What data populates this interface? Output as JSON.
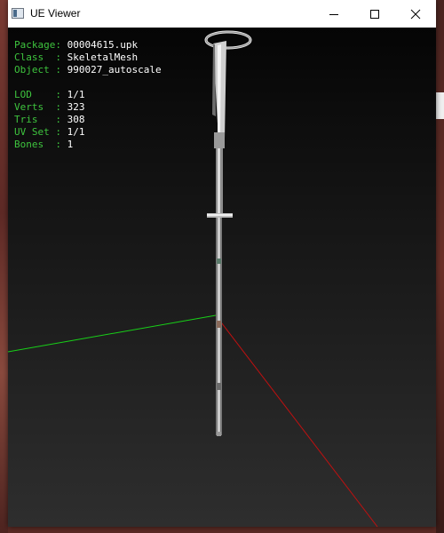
{
  "window": {
    "title": "UE Viewer",
    "controls": [
      "minimize",
      "maximize",
      "close"
    ]
  },
  "info": {
    "package_label": "Package: ",
    "package": "00004615.upk",
    "class_label": "Class  : ",
    "class": "SkeletalMesh",
    "object_label": "Object : ",
    "object": "990027_autoscale",
    "lod_label": "LOD    : ",
    "lod": "1/1",
    "verts_label": "Verts  : ",
    "verts": "323",
    "tris_label": "Tris   : ",
    "tris": "308",
    "uvset_label": "UV Set : ",
    "uvset": "1/1",
    "bones_label": "Bones  : ",
    "bones": "1"
  },
  "colors": {
    "label": "#3ec43e",
    "value": "#ffffff",
    "axis_x": "#c01010",
    "axis_y": "#18d018"
  }
}
